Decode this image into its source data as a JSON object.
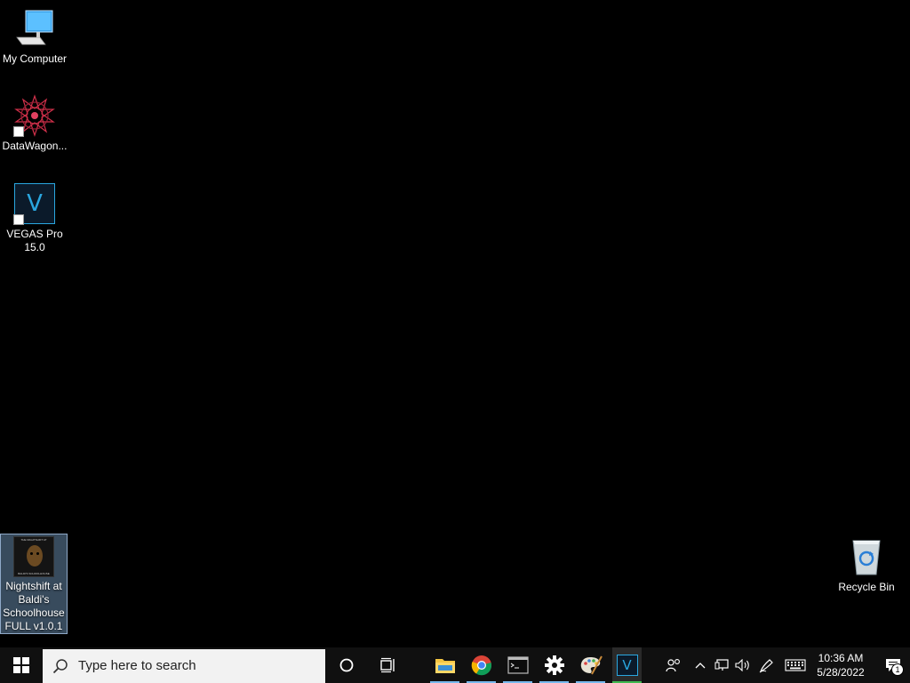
{
  "desktop": {
    "icons": [
      {
        "label": "My Computer",
        "icon": "computer-icon"
      },
      {
        "label": "DataWagon...",
        "icon": "datawagon-icon"
      },
      {
        "label": "VEGAS Pro 15.0",
        "icon": "vegas-pro-icon",
        "glyph": "V"
      },
      {
        "label": "Nightshift at Baldi's Schoolhouse FULL v1.0.1",
        "icon": "nightshift-game-icon",
        "art_caption_top": "THE NIGHTSHIFT AT",
        "art_caption_bottom": "BALDI'S SCHOOLHOUSE"
      },
      {
        "label": "Recycle Bin",
        "icon": "recycle-bin-icon"
      }
    ]
  },
  "taskbar": {
    "start_icon": "windows-start-icon",
    "search_placeholder": "Type here to search",
    "apps": [
      {
        "name": "cortana",
        "icon": "cortana-icon"
      },
      {
        "name": "task-view",
        "icon": "task-view-icon"
      },
      {
        "name": "file-explorer",
        "icon": "folder-icon",
        "running": true
      },
      {
        "name": "chrome",
        "icon": "chrome-icon",
        "running": true
      },
      {
        "name": "command-prompt",
        "icon": "terminal-icon",
        "running": true
      },
      {
        "name": "settings",
        "icon": "gear-icon",
        "running": true
      },
      {
        "name": "paint",
        "icon": "paint-palette-icon",
        "running": true
      },
      {
        "name": "vegas-pro",
        "icon": "vegas-pro-icon",
        "glyph": "V",
        "active": true
      }
    ],
    "tray": {
      "time": "10:36 AM",
      "date": "5/28/2022",
      "notification_count": "1"
    }
  },
  "colors": {
    "desktop_bg": "#000000",
    "taskbar_bg": "#101010",
    "accent": "#76b9ed",
    "vegas_blue": "#2aa7e0"
  }
}
